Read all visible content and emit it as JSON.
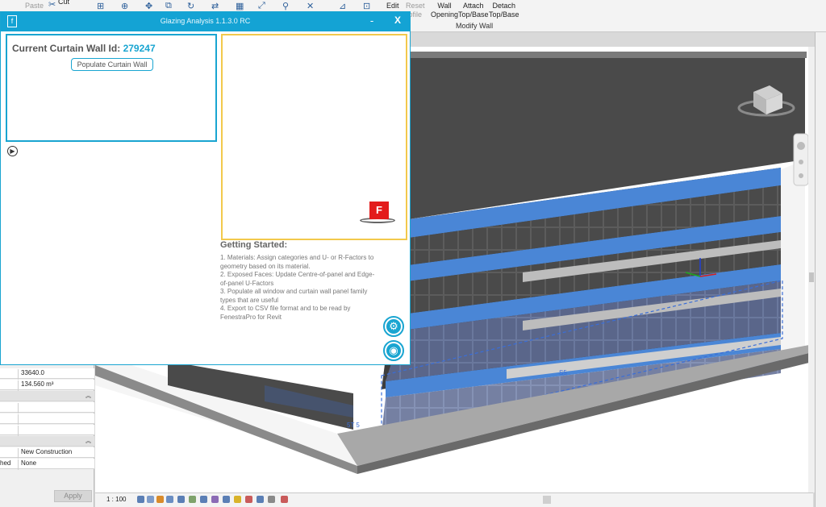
{
  "ribbon": {
    "paste_label": "Paste",
    "cut_label": "Cut",
    "edit_label": "Edit",
    "reset_label": "Reset",
    "reset_sub": "ofile",
    "wall_label": "Wall",
    "opening_label": "Opening",
    "attach_label": "Attach",
    "attach_sub": "Top/Base",
    "detach_label": "Detach",
    "detach_sub": "Top/Base",
    "modify_wall_panel": "Modify Wall"
  },
  "dialog": {
    "title": "Glazing Analysis 1.1.3.0 RC",
    "minimize": "-",
    "close": "X",
    "wall_label": "Current Curtain Wall Id:",
    "wall_id": "279247",
    "populate_button": "Populate Curtain Wall",
    "getting_started_title": "Getting Started:",
    "getting_started_lines": [
      "1. Materials: Assign categories and U- or R-Factors to geometry based on its material.",
      "2. Exposed Faces: Update Centre-of-panel and Edge-of-panel U-Factors",
      "3. Populate all window and curtain wall panel family types that are useful",
      "4. Export to CSV file format and to be read by FenestraPro for Revit"
    ],
    "logo_letter": "F",
    "colors": {
      "accent": "#14a3d4",
      "image_border": "#f2c94c",
      "logo": "#e31c1c"
    },
    "icons": [
      "settings-icon",
      "camera-icon",
      "expand-arrow-icon"
    ]
  },
  "properties": {
    "rows": [
      {
        "value": "33640.0"
      },
      {
        "value": "134.560 m³"
      },
      {
        "value": ""
      },
      {
        "value": ""
      },
      {
        "value": ""
      },
      {
        "value": ""
      },
      {
        "value": "New Construction"
      },
      {
        "label": "hed",
        "value": "None"
      }
    ],
    "apply_button": "Apply"
  },
  "statusbar": {
    "scale": "1 : 100"
  },
  "viewport": {
    "labels": [
      "5T 5",
      "S5"
    ]
  }
}
